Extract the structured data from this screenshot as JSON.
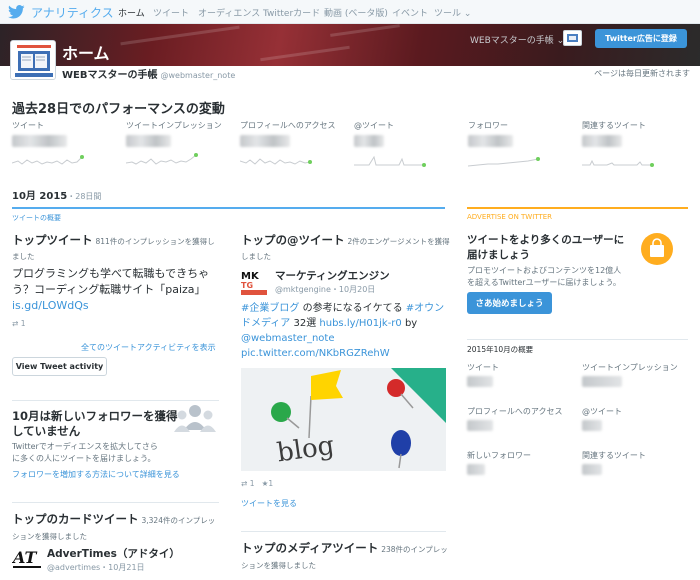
{
  "nav": {
    "brand": "アナリティクス",
    "items": [
      {
        "label": "ホーム",
        "active": true
      },
      {
        "label": "ツイート"
      },
      {
        "label": "オーディエンス"
      },
      {
        "label": "Twitterカード"
      },
      {
        "label": "動画 (ベータ版)"
      },
      {
        "label": "イベント"
      },
      {
        "label": "ツール"
      }
    ]
  },
  "header": {
    "title": "ホーム",
    "account_menu": "WEBマスターの手帳",
    "ads_button": "Twitter広告に登録",
    "account_name": "WEBマスターの手帳",
    "handle": "@webmaster_note",
    "update_note": "ページは毎日更新されます"
  },
  "performance": {
    "title": "過去28日でのパフォーマンスの変動",
    "metrics": [
      {
        "label": "ツイート"
      },
      {
        "label": "ツイートインプレッション"
      },
      {
        "label": "プロフィールへのアクセス"
      },
      {
        "label": "@ツイート"
      },
      {
        "label": "フォロワー"
      },
      {
        "label": "関連するツイート"
      }
    ]
  },
  "period": {
    "month": "10月 2015",
    "days": "・28日間"
  },
  "overview_label": "ツイートの概要",
  "top_tweet": {
    "title": "トップツイート",
    "impressions": "811件のインプレッションを獲得し",
    "impressions_cont": "ました",
    "text_line1": "プログラミングも学べて転職もできちゃ",
    "text_line2": "う？コーディング転職サイト「paiza」",
    "link": "is.gd/LOWdQs",
    "retweets": "1",
    "all_activity": "全てのツイートアクティビティを表示",
    "view_button": "View Tweet activity"
  },
  "followers_card": {
    "title_line1": "10月は新しいフォロワーを獲得",
    "title_line2": "していません",
    "text_line1": "Twitterでオーディエンスを拡大してさら",
    "text_line2": "に多くの人にツイートを届けましょう。",
    "link": "フォロワーを増加する方法について詳細を見る"
  },
  "top_card": {
    "title": "トップのカードツイート",
    "impressions": "3,324件のインプレッ",
    "impressions_cont": "ションを獲得しました",
    "user_name": "AdverTimes（アドタイ）",
    "user_handle": "@advertimes",
    "date": "・10月21日"
  },
  "top_mention": {
    "title": "トップの@ツイート",
    "engagements": "2件のエンゲージメントを獲得",
    "engagements_cont": "しました",
    "user_name": "マーケティングエンジン",
    "user_handle": "@mktgengine",
    "date": "・10月20日",
    "hashtag1": "#企業ブログ",
    "text1": " の参考になるイケてる ",
    "hashtag2": "#オウン",
    "hashtag2_cont": "ドメディア",
    "count": " 32選 ",
    "link1": "hubs.ly/H01jk-r0",
    "by": " by",
    "mention": "@webmaster_note",
    "pic": "pic.twitter.com/NKbRGZRehW",
    "retweets": "1",
    "likes": "1",
    "view_link": "ツイートを見る",
    "image_word": "blog"
  },
  "top_media": {
    "title": "トップのメディアツイート",
    "impressions": "238件のインプレッ",
    "impressions_cont": "ションを獲得しました"
  },
  "advertise": {
    "label": "ADVERTISE ON TWITTER",
    "title_line1": "ツイートをより多くのユーザーに",
    "title_line2": "届けましょう",
    "text_line1": "プロモツイートおよびコンテンツを12億人",
    "text_line2": "を超えるTwitterユーザーに届けましょう。",
    "button": "さあ始めましょう"
  },
  "summary": {
    "title": "2015年10月の概要",
    "items": [
      {
        "label": "ツイート"
      },
      {
        "label": "ツイートインプレッション"
      },
      {
        "label": "プロフィールへのアクセス"
      },
      {
        "label": "@ツイート"
      },
      {
        "label": "新しいフォロワー"
      },
      {
        "label": "関連するツイート"
      }
    ]
  },
  "colors": {
    "accent": "#3b94d9",
    "twitter_blue": "#55acee",
    "advertise": "#ffad1f",
    "hashtag": "#3b94d9"
  }
}
